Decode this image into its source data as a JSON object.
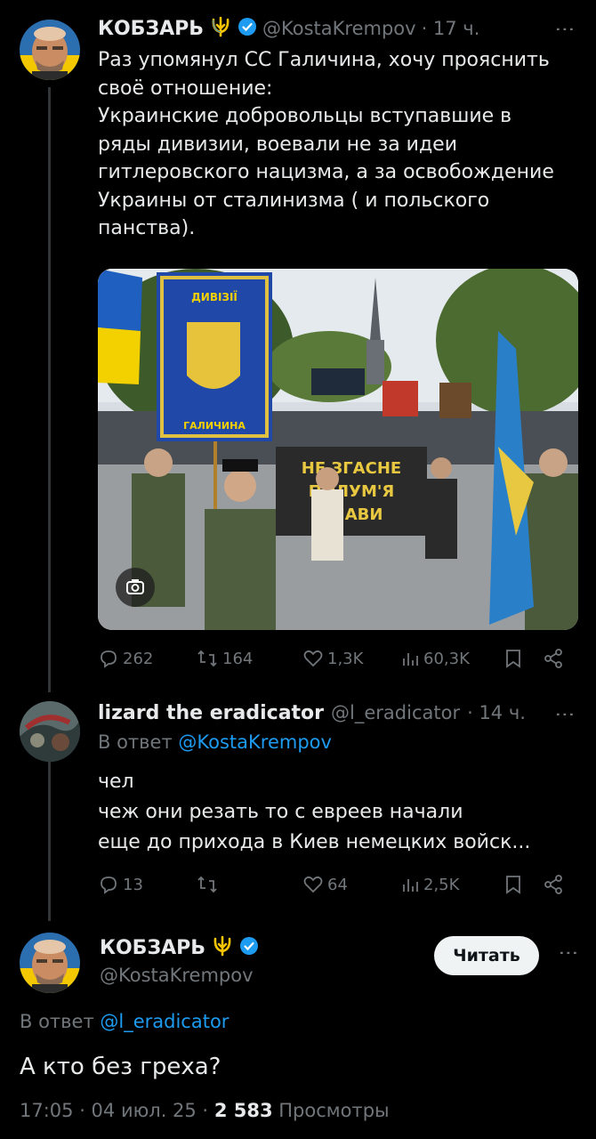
{
  "colors": {
    "background": "#000000",
    "text": "#e7e9ea",
    "muted": "#71767b",
    "link": "#1d9bf0",
    "verified": "#1d9bf0",
    "trident": "#f5c400"
  },
  "tweet1": {
    "display_name": "КОБЗАРЬ",
    "name_emoji": "trident-icon",
    "handle": "@KostaKrempov",
    "time": "· 17 ч.",
    "text": "Раз упомянул СС Галичина, хочу прояснить\nсвоё отношение:\nУкраинские добровольцы вступавшие в\nряды дивизии, воевали не за идеи\nгитлеровского нацизма, а за освобождение\nУкраины от сталинизма ( и польского\nпанства).",
    "image": {
      "banner_text": "ДИВІЗІЇ",
      "banner_bottom": "ГАЛИЧИНА",
      "placard_text": "НЕ ЗГАСНЕ ПОЛУМ'Я СЛАВИ"
    },
    "replies": "262",
    "retweets": "164",
    "likes": "1,3K",
    "views": "60,3K"
  },
  "tweet2": {
    "display_name": "lizard the eradicator",
    "handle": "@l_eradicator",
    "time": "· 14 ч.",
    "reply_prefix": "В ответ",
    "reply_to": "@KostaKrempov",
    "text": "чел\nчеж они резать то с евреев начали\nеще до прихода в Киев немецких войск...",
    "replies": "13",
    "retweets": "",
    "likes": "64",
    "views": "2,5K"
  },
  "tweet3": {
    "display_name": "КОБЗАРЬ",
    "handle": "@KostaKrempov",
    "follow_label": "Читать",
    "reply_prefix": "В ответ",
    "reply_to": "@l_eradicator",
    "text": "А кто без греха?",
    "timestamp": "17:05 · 04 июл. 25 ·",
    "views_count": "2 583",
    "views_label": "Просмотры"
  }
}
